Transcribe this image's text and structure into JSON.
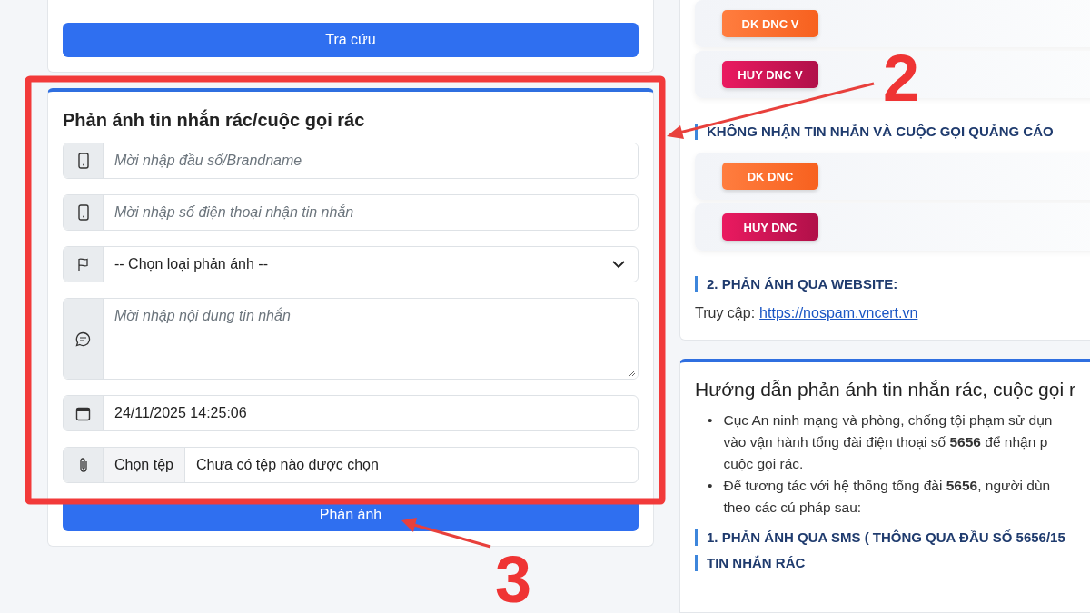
{
  "lookup_card": {
    "button": "Tra cứu"
  },
  "report_form": {
    "title": "Phản ánh tin nhắn rác/cuộc gọi rác",
    "fields": [
      {
        "kind": "text",
        "placeholder": "Mời nhập đầu số/Brandname"
      },
      {
        "kind": "text",
        "placeholder": "Mời nhập số điện thoại nhận tin nhắn"
      },
      {
        "kind": "select",
        "value": "-- Chọn loại phản ánh --"
      },
      {
        "kind": "textarea",
        "placeholder": "Mời nhập nội dung tin nhắn"
      },
      {
        "kind": "datetime",
        "value": "24/11/2025 14:25:06"
      },
      {
        "kind": "file",
        "button": "Chọn tệp",
        "value": "Chưa có tệp nào được chọn"
      }
    ],
    "submit": "Phản ánh"
  },
  "dnc_card": {
    "items": [
      {
        "kind": "register",
        "label": "DK DNC V"
      },
      {
        "kind": "cancel",
        "label": "HUY DNC V"
      },
      {
        "kind": "heading",
        "label": "KHÔNG NHẬN TIN NHẮN VÀ CUỘC GỌI QUẢNG CÁO"
      },
      {
        "kind": "register",
        "label": "DK DNC"
      },
      {
        "kind": "cancel",
        "label": "HUY DNC"
      },
      {
        "kind": "heading",
        "label": "2. PHẢN ÁNH QUA WEBSITE:"
      }
    ],
    "website": {
      "label": "Truy cập:",
      "link": "https://nospam.vncert.vn"
    }
  },
  "guide_card": {
    "title": "Hướng dẫn phản ánh tin nhắn rác, cuộc gọi r",
    "marker": "•",
    "bullets": [
      "Cục An ninh mạng và phòng, chống tội phạm sử dụn\nvào vận hành tổng đài điện thoại số **5656** để nhận p\ncuộc gọi rác.",
      "Để tương tác với hệ thống tổng đài **5656**, người dùn\ntheo các cú pháp sau:"
    ],
    "headings": [
      "1. PHẢN ÁNH QUA SMS ( THÔNG QUA ĐẦU SỐ 5656/15",
      "TIN NHẮN RÁC"
    ]
  },
  "annotations": [
    {
      "label": "2"
    },
    {
      "label": "3"
    }
  ]
}
